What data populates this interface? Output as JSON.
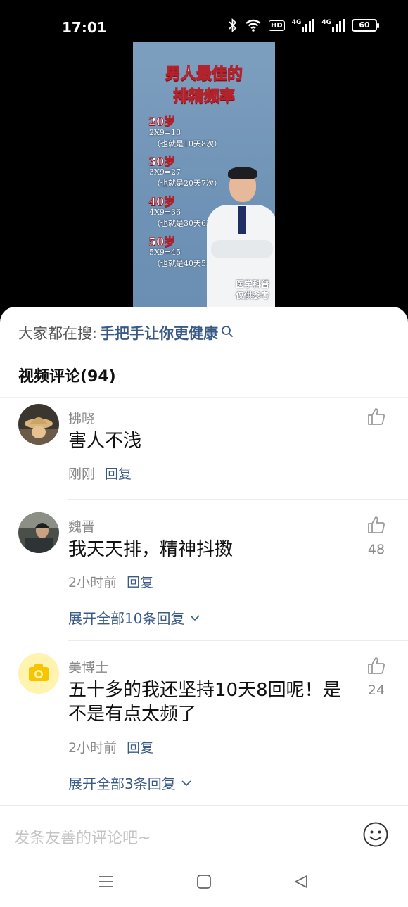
{
  "status_bar": {
    "time": "17:01",
    "battery": "60",
    "hd": "HD",
    "net1": "4G",
    "net2": "4G"
  },
  "poster": {
    "title_line1": "男人最佳的",
    "title_line2": "排精频率",
    "rows": [
      {
        "age": "20岁",
        "formula": "2X9=18",
        "note": "（也就是10天8次）"
      },
      {
        "age": "30岁",
        "formula": "3X9=27",
        "note": "（也就是20天7次）"
      },
      {
        "age": "40岁",
        "formula": "4X9=36",
        "note": "（也就是30天6次）"
      },
      {
        "age": "50岁",
        "formula": "5X9=45",
        "note": "（也就是40天5次）"
      }
    ],
    "caption_line1": "医学科普",
    "caption_line2": "仅供参考"
  },
  "hot_search": {
    "label": "大家都在搜:",
    "keyword": "手把手让你更健康"
  },
  "comments_header": "视频评论(94)",
  "comments": [
    {
      "user": "拂晓",
      "text": "害人不浅",
      "time": "刚刚",
      "reply": "回复",
      "likes": "",
      "expand": ""
    },
    {
      "user": "魏晋",
      "text": "我天天排，精神抖擞",
      "time": "2小时前",
      "reply": "回复",
      "likes": "48",
      "expand": "展开全部10条回复"
    },
    {
      "user": "美博士",
      "text": "五十多的我还坚持10天8回呢！是不是有点太频了",
      "time": "2小时前",
      "reply": "回复",
      "likes": "24",
      "expand": "展开全部3条回复"
    }
  ],
  "input": {
    "placeholder": "发条友善的评论吧~"
  },
  "colors": {
    "accent": "#3a5a86",
    "poster_bg": "#7396b9",
    "poster_title_stroke": "#b2232b"
  }
}
